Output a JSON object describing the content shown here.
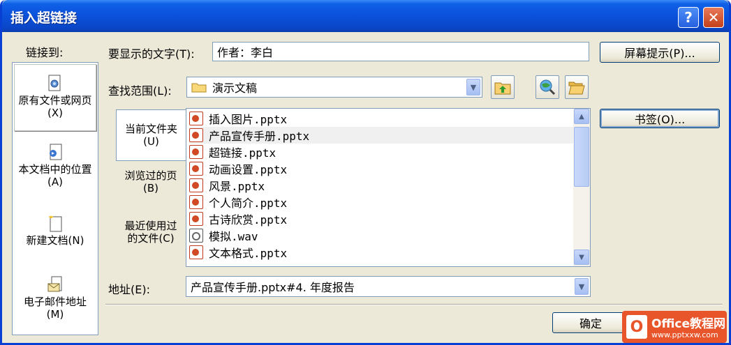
{
  "window": {
    "title": "插入超链接",
    "help_label": "?",
    "close_label": "✕"
  },
  "link_to": {
    "label": "链接到:",
    "places": [
      {
        "label": "原有文件或网页(X)",
        "icon": "existing-file-icon"
      },
      {
        "label": "本文档中的位置(A)",
        "icon": "place-in-document-icon"
      },
      {
        "label": "新建文档(N)",
        "icon": "new-document-icon"
      },
      {
        "label": "电子邮件地址(M)",
        "icon": "email-address-icon"
      }
    ]
  },
  "display_text": {
    "label": "要显示的文字(T):",
    "value": "作者：李白"
  },
  "screen_tip_button": "屏幕提示(P)...",
  "look_in": {
    "label": "查找范围(L):",
    "value": "演示文稿"
  },
  "tabs": [
    {
      "label": "当前文件夹(U)"
    },
    {
      "label": "浏览过的页(B)"
    },
    {
      "label": "最近使用过的文件(C)"
    }
  ],
  "files": [
    {
      "name": "插入图片.pptx",
      "type": "pptx"
    },
    {
      "name": "产品宣传手册.pptx",
      "type": "pptx"
    },
    {
      "name": "超链接.pptx",
      "type": "pptx"
    },
    {
      "name": "动画设置.pptx",
      "type": "pptx"
    },
    {
      "name": "风景.pptx",
      "type": "pptx"
    },
    {
      "name": "个人简介.pptx",
      "type": "pptx"
    },
    {
      "name": "古诗欣赏.pptx",
      "type": "pptx"
    },
    {
      "name": "模拟.wav",
      "type": "wav"
    },
    {
      "name": "文本格式.pptx",
      "type": "pptx"
    }
  ],
  "bookmark_button": "书签(O)...",
  "address": {
    "label": "地址(E):",
    "value": "产品宣传手册.pptx#4. 年度报告"
  },
  "ok_button": "确定",
  "watermark": {
    "brand": "Office教程网",
    "url": "www.pptxxw.com"
  }
}
